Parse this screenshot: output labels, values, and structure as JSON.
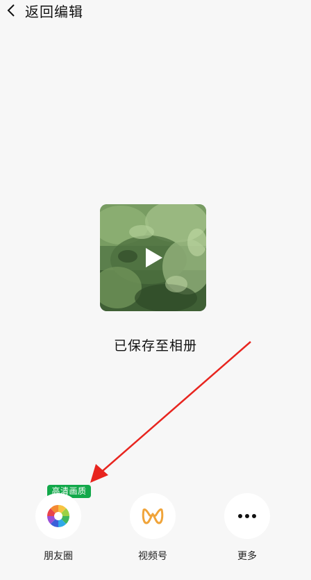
{
  "header": {
    "back_label": "返回编辑"
  },
  "media": {
    "thumbnail": "video-thumbnail",
    "play_icon": "play-icon"
  },
  "status": {
    "saved_text": "已保存至相册"
  },
  "share": {
    "badge": "高清画质",
    "items": [
      {
        "label": "朋友圈",
        "icon": "moments-icon"
      },
      {
        "label": "视频号",
        "icon": "channels-icon"
      },
      {
        "label": "更多",
        "icon": "more-icon"
      }
    ]
  },
  "colors": {
    "background": "#f7f7f7",
    "badge_green": "#12a84a",
    "arrow_red": "#e8251f",
    "channels_orange": "#f0a43a"
  }
}
